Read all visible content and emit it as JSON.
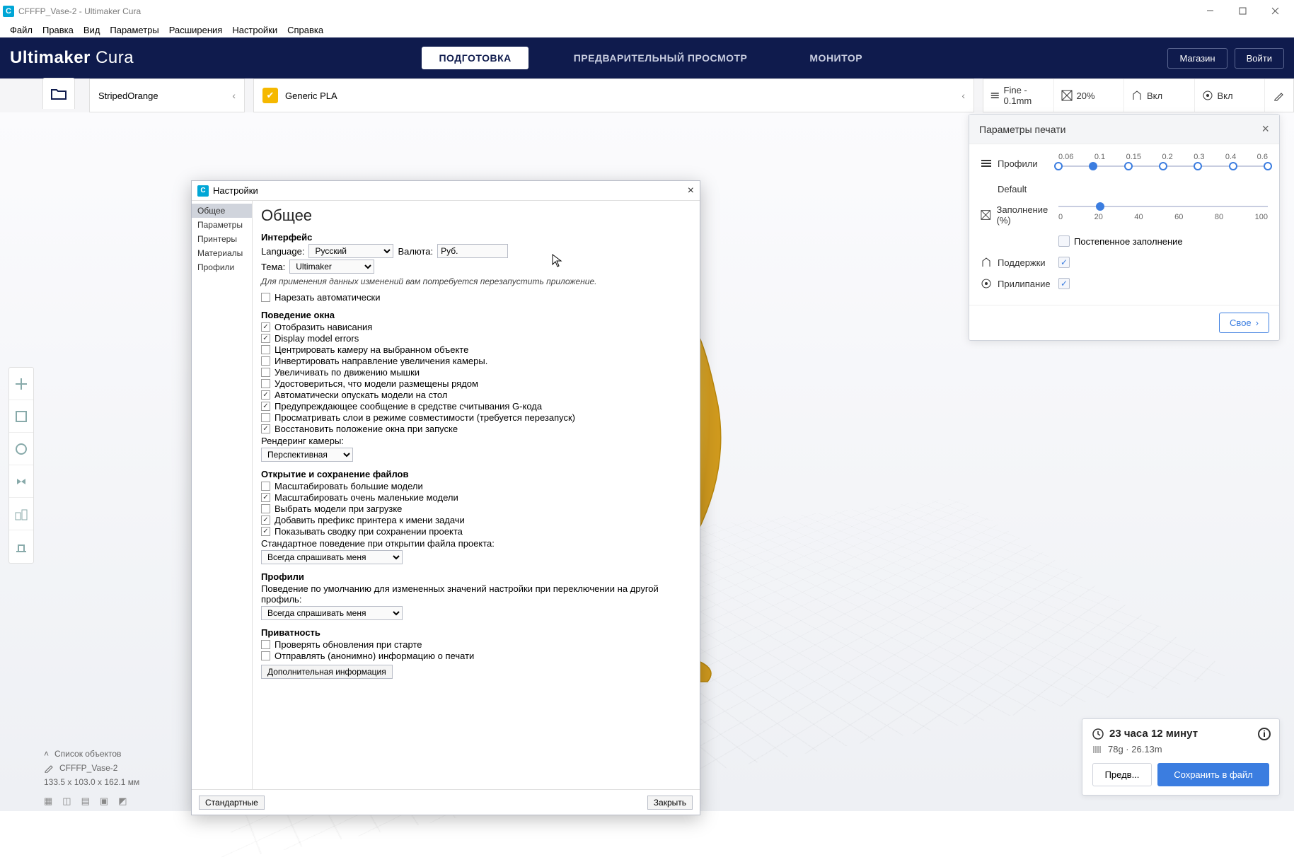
{
  "window": {
    "title": "CFFFP_Vase-2 - Ultimaker Cura"
  },
  "menubar": {
    "items": [
      "Файл",
      "Правка",
      "Вид",
      "Параметры",
      "Расширения",
      "Настройки",
      "Справка"
    ]
  },
  "header": {
    "brand_bold": "Ultimaker",
    "brand_light": "Cura",
    "stages": {
      "prepare": "ПОДГОТОВКА",
      "preview": "ПРЕДВАРИТЕЛЬНЫЙ ПРОСМОТР",
      "monitor": "МОНИТОР"
    },
    "marketplace": "Магазин",
    "signin": "Войти"
  },
  "toolbar": {
    "printer": "StripedOrange",
    "material": "Generic PLA",
    "quality_label": "Fine - 0.1mm",
    "infill_pct": "20%",
    "support": "Вкл",
    "adhesion": "Вкл"
  },
  "print_settings": {
    "title": "Параметры печати",
    "profiles_label": "Профили",
    "default_label": "Default",
    "profile_ticks": [
      "0.06",
      "0.1",
      "0.15",
      "0.2",
      "0.3",
      "0.4",
      "0.6"
    ],
    "profile_selected_index": 1,
    "infill_label": "Заполнение (%)",
    "infill_ticks": [
      "0",
      "20",
      "40",
      "60",
      "80",
      "100"
    ],
    "infill_selected_index": 1,
    "gradual_label": "Постепенное заполнение",
    "gradual_checked": false,
    "support_label": "Поддержки",
    "support_checked": true,
    "adhesion_label": "Прилипание",
    "adhesion_checked": true,
    "custom_btn": "Свое"
  },
  "bottom_left": {
    "objects_list": "Список объектов",
    "object_name": "CFFFP_Vase-2",
    "dims": "133.5 x 103.0 x 162.1 мм"
  },
  "bottom_right": {
    "time": "23 часа 12 минут",
    "material": "78g · 26.13m",
    "preview_btn": "Предв...",
    "save_btn": "Сохранить в файл"
  },
  "prefs": {
    "title": "Настройки",
    "side": {
      "general": "Общее",
      "settings": "Параметры",
      "printers": "Принтеры",
      "materials": "Материалы",
      "profiles": "Профили"
    },
    "heading": "Общее",
    "interface_h": "Интерфейс",
    "language_l": "Language:",
    "language_v": "Русский",
    "currency_l": "Валюта:",
    "currency_v": "Руб.",
    "theme_l": "Тема:",
    "theme_v": "Ultimaker",
    "restart_note": "Для применения данных изменений вам потребуется перезапустить приложение.",
    "slice_auto": "Нарезать автоматически",
    "viewport_h": "Поведение окна",
    "cb_overhang": "Отобразить нависания",
    "cb_model_err": "Display model errors",
    "cb_center_cam": "Центрировать камеру на выбранном объекте",
    "cb_invert_zoom": "Инвертировать направление увеличения камеры.",
    "cb_zoom_mouse": "Увеличивать по движению мышки",
    "cb_ensure_fit": "Удостовериться, что модели размещены рядом",
    "cb_drop_down": "Автоматически опускать модели на стол",
    "cb_gcode_warn": "Предупреждающее сообщение в средстве считывания G-кода",
    "cb_compat_layers": "Просматривать слои в режиме совместимости (требуется перезапуск)",
    "cb_restore_win": "Восстановить положение окна при запуске",
    "camera_render_l": "Рендеринг камеры:",
    "camera_render_v": "Перспективная",
    "files_h": "Открытие и сохранение файлов",
    "cb_scale_large": "Масштабировать большие модели",
    "cb_scale_small": "Масштабировать очень маленькие модели",
    "cb_select_on_load": "Выбрать модели при загрузке",
    "cb_prefix_job": "Добавить префикс принтера к имени задачи",
    "cb_save_summary": "Показывать сводку при сохранении проекта",
    "default_open_l": "Стандартное поведение при открытии файла проекта:",
    "default_open_v": "Всегда спрашивать меня",
    "profiles_h": "Профили",
    "profiles_note": "Поведение по умолчанию для измененных значений настройки при переключении на другой профиль:",
    "profiles_v": "Всегда спрашивать меня",
    "privacy_h": "Приватность",
    "cb_check_updates": "Проверять обновления при старте",
    "cb_send_anon": "Отправлять (анонимно) информацию о печати",
    "more_info_btn": "Дополнительная информация",
    "footer_defaults": "Стандартные",
    "footer_close": "Закрыть"
  }
}
